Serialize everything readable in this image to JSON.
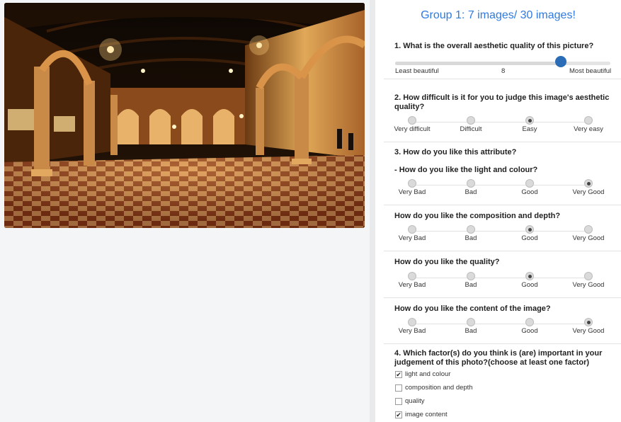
{
  "photo": {
    "subject": "illuminated loggia with arches and checkered marble floor at night"
  },
  "survey": {
    "title": "Group 1: 7 images/ 30 images!",
    "q1": {
      "text": "1. What is the overall aesthetic quality of this picture?",
      "min_label": "Least beautiful",
      "max_label": "Most beautiful",
      "value": "8",
      "fraction": 0.8
    },
    "q2": {
      "text": "2. How difficult is it for you to judge this image's aesthetic quality?",
      "options": [
        "Very difficult",
        "Difficult",
        "Easy",
        "Very easy"
      ],
      "selected": "Easy"
    },
    "q3": {
      "text": "3. How do you like this attribute?",
      "light": {
        "text": "- How do you like the light and colour?",
        "options": [
          "Very Bad",
          "Bad",
          "Good",
          "Very Good"
        ],
        "selected": "Very Good"
      },
      "composition": {
        "text": "How do you like the composition and depth?",
        "options": [
          "Very Bad",
          "Bad",
          "Good",
          "Very Good"
        ],
        "selected": "Good"
      },
      "quality": {
        "text": "How do you like the quality?",
        "options": [
          "Very Bad",
          "Bad",
          "Good",
          "Very Good"
        ],
        "selected": "Good"
      },
      "content": {
        "text": "How do you like the content of the image?",
        "options": [
          "Very Bad",
          "Bad",
          "Good",
          "Very Good"
        ],
        "selected": "Very Good"
      }
    },
    "q4": {
      "text": "4. Which factor(s) do you think is (are) important in your judgement of this photo?(choose at least one factor)",
      "factors": [
        {
          "label": "light and colour",
          "checked": true
        },
        {
          "label": "composition and depth",
          "checked": false
        },
        {
          "label": "quality",
          "checked": false
        },
        {
          "label": "image content",
          "checked": true
        }
      ]
    }
  },
  "colors": {
    "title": "#2f7ae0",
    "slider_thumb": "#2a6cb5"
  }
}
